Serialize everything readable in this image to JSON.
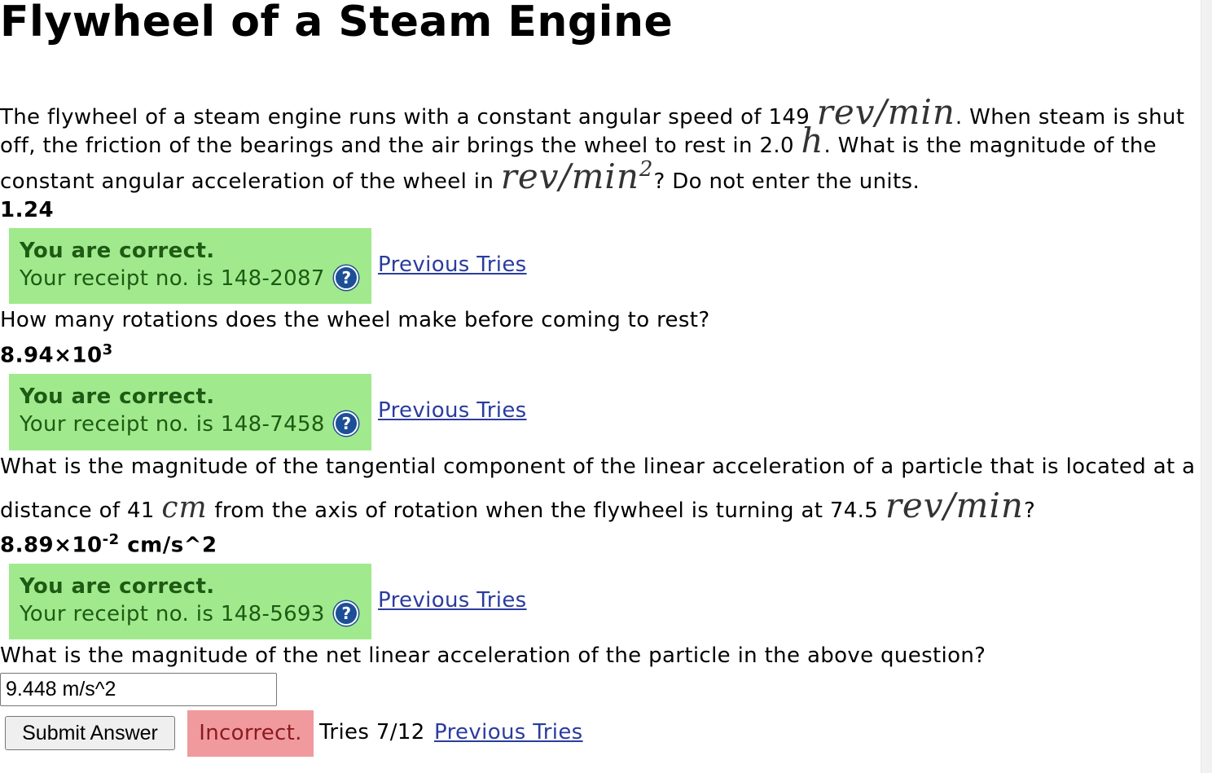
{
  "page": {
    "title": "Flywheel of a Steam Engine"
  },
  "problem": {
    "intro_a": "The flywheel of a steam engine runs with a constant angular speed of 149",
    "unit_rev_min": "rev/min",
    "intro_b": ". When steam is shut",
    "intro_c": "off, the friction of the bearings and the air brings the wheel to rest in 2.0",
    "unit_h": "h",
    "intro_d": ". What is the magnitude of the",
    "intro_e": "constant angular acceleration of the wheel in",
    "unit_rev_min2": "rev/min",
    "unit_rev_min2_exp": "2",
    "intro_f": "? Do not enter the units."
  },
  "parts": [
    {
      "answer": "1.24",
      "feedback_title": "You are correct.",
      "receipt_label": "Your receipt no. is 148-2087",
      "previous_tries": "Previous Tries"
    },
    {
      "question": "How many rotations does the wheel make before coming to rest?",
      "answer_mantissa": "8.94×10",
      "answer_exp": "3",
      "feedback_title": "You are correct.",
      "receipt_label": "Your receipt no. is 148-7458",
      "previous_tries": "Previous Tries"
    },
    {
      "question_a": "What is the magnitude of the tangential component of the linear acceleration of a particle that is located at a",
      "question_b": "distance of 41",
      "unit_cm": "cm",
      "question_c": "from the axis of rotation when the flywheel is turning at 74.5",
      "unit_rev_min": "rev/min",
      "question_d": "?",
      "answer_mantissa": "8.89×10",
      "answer_exp": "-2",
      "answer_unit": "cm/s^2",
      "feedback_title": "You are correct.",
      "receipt_label": "Your receipt no. is 148-5693",
      "previous_tries": "Previous Tries"
    },
    {
      "question": "What is the magnitude of the net linear acceleration of the particle in the above question?",
      "input_value": "9.448 m/s^2",
      "submit_label": "Submit Answer",
      "status": "Incorrect.",
      "tries": "Tries 7/12",
      "previous_tries": "Previous Tries"
    }
  ],
  "icons": {
    "help": "question-help-icon"
  },
  "colors": {
    "correct_bg": "#a0ea8d",
    "correct_text": "#1f5a14",
    "incorrect_bg": "#f09a9e",
    "incorrect_text": "#8a1a1f",
    "link": "#2a3c9e"
  }
}
